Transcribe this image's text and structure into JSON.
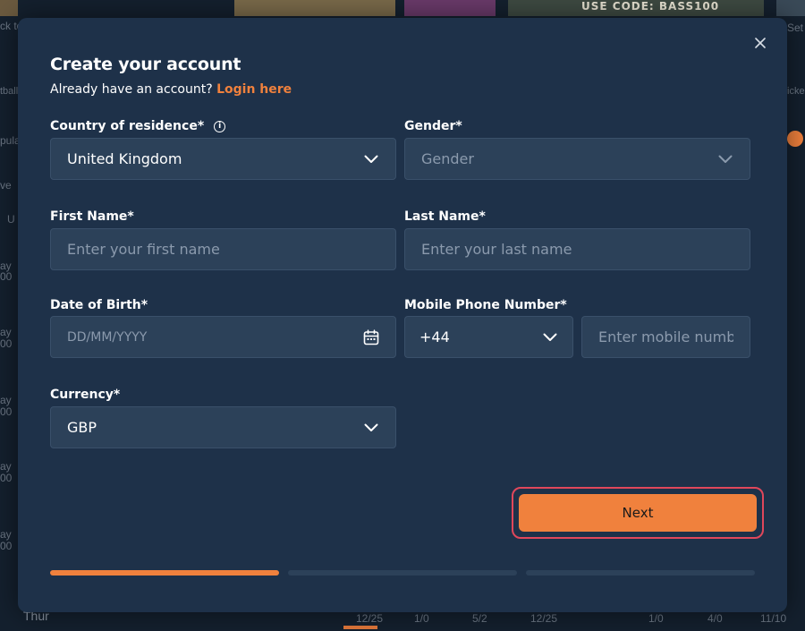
{
  "background": {
    "promo_text": "USE CODE: BASS100",
    "left_texts": [
      "ck to",
      "tball",
      "pula",
      "ve",
      "U",
      "ay",
      "00",
      "ay",
      "00",
      "ay",
      "00",
      "ay",
      "00",
      "ay",
      "00",
      "Thur"
    ],
    "right_texts": [
      "Set",
      "icke"
    ],
    "bottom_texts": [
      "12/25",
      "1/0",
      "5/2",
      "12/25",
      "1/0",
      "4/0",
      "11/10"
    ]
  },
  "modal": {
    "title": "Create your account",
    "subtitle_prefix": "Already have an account?",
    "login_link": "Login here",
    "close_icon": "close-icon"
  },
  "form": {
    "country": {
      "label": "Country of residence*",
      "value": "United Kingdom",
      "info_icon": "i"
    },
    "gender": {
      "label": "Gender*",
      "placeholder": "Gender"
    },
    "first_name": {
      "label": "First Name*",
      "placeholder": "Enter your first name"
    },
    "last_name": {
      "label": "Last Name*",
      "placeholder": "Enter your last name"
    },
    "dob": {
      "label": "Date of Birth*",
      "placeholder": "DD/MM/YYYY"
    },
    "mobile": {
      "label": "Mobile Phone Number*",
      "code": "+44",
      "placeholder": "Enter mobile number"
    },
    "currency": {
      "label": "Currency*",
      "value": "GBP"
    }
  },
  "actions": {
    "next_label": "Next"
  },
  "progress": {
    "steps": 3,
    "current": 1
  },
  "colors": {
    "accent": "#f0813d",
    "modal_bg": "#1e3149",
    "field_bg": "#2c4159",
    "focus_outline": "#e0475b"
  }
}
